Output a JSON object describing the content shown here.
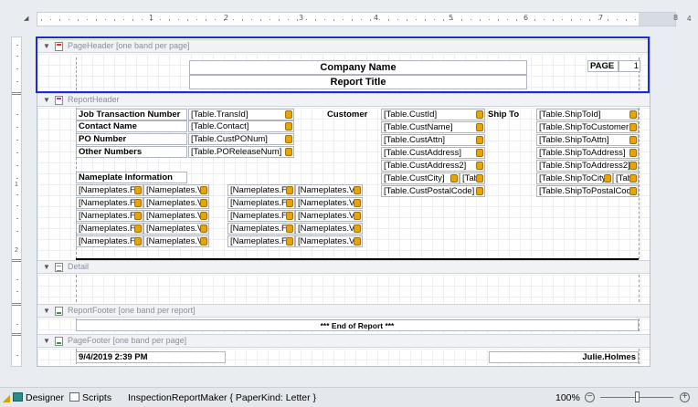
{
  "ruler": {
    "marks": [
      "1",
      "2",
      "3",
      "4",
      "5",
      "6",
      "7",
      "8"
    ],
    "corner": "4"
  },
  "vruler": {
    "marks": [
      "1",
      "2"
    ]
  },
  "bands": {
    "page_header": {
      "title": "PageHeader [one band per page]"
    },
    "report_header": {
      "title": "ReportHeader"
    },
    "detail": {
      "title": "Detail"
    },
    "report_footer": {
      "title": "ReportFooter [one band per report]"
    },
    "page_footer": {
      "title": "PageFooter [one band per page]"
    }
  },
  "page_header": {
    "company_name": "Company Name",
    "report_title": "Report Title",
    "page_label": "PAGE",
    "page_number": "1"
  },
  "report_header": {
    "labels": {
      "job_transaction_number": "Job Transaction Number",
      "contact_name": "Contact Name",
      "po_number": "PO Number",
      "other_numbers": "Other Numbers",
      "nameplate_information": "Nameplate Information",
      "customer": "Customer",
      "ship_to": "Ship To"
    },
    "fields_left": [
      "[Table.TransId]",
      "[Table.Contact]",
      "[Table.CustPONum]",
      "[Table.POReleaseNum]"
    ],
    "fields_customer": [
      "[Table.CustId]",
      "[Table.CustName]",
      "[Table.CustAttn]",
      "[Table.CustAddress]",
      "[Table.CustAddress2]",
      "[Table.CustCity]",
      "[Table.CustPostalCode]"
    ],
    "cust_extra": "[Tab",
    "fields_shipto": [
      "[Table.ShipToId]",
      "[Table.ShipToCustomerI",
      "[Table.ShipToAttn]",
      "[Table.ShipToAddress]",
      "[Table.ShipToAddress2]",
      "[Table.ShipToCity]",
      "[Table.ShipToPostalCode"
    ],
    "ship_extra": "[Tab",
    "nameplate_fields": {
      "col1": "[Nameplates.F",
      "col2": "[Nameplates.V",
      "col3": "[Nameplates.F",
      "col4": "[Nameplates.V"
    }
  },
  "report_footer": {
    "end_text": "*** End of Report ***"
  },
  "page_footer": {
    "date": "9/4/2019 2:39 PM",
    "user": "Julie.Holmes"
  },
  "statusbar": {
    "designer": "Designer",
    "scripts": "Scripts",
    "report_info": "InspectionReportMaker { PaperKind: Letter }",
    "zoom": "100%",
    "zoom_out": "−",
    "zoom_in": "+"
  },
  "colors": {
    "highlight": "#1a2bd0",
    "field_icon": "#e8a400"
  }
}
